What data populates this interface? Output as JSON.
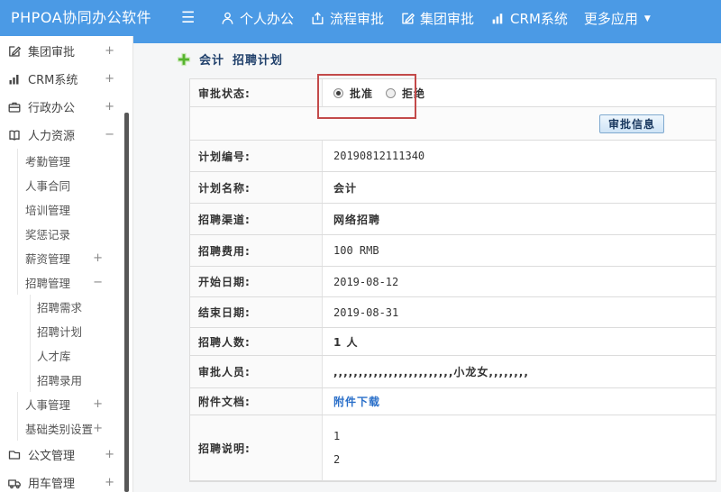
{
  "header": {
    "logo": "PHPOA协同办公软件",
    "menu_icon": "hamburger-menu-icon",
    "nav": [
      {
        "id": "personal-office",
        "label": "个人办公",
        "icon": "person-icon"
      },
      {
        "id": "process-approval",
        "label": "流程审批",
        "icon": "flow-icon"
      },
      {
        "id": "group-approval",
        "label": "集团审批",
        "icon": "edit-icon"
      },
      {
        "id": "crm-system",
        "label": "CRM系统",
        "icon": "chart-icon"
      },
      {
        "id": "more-apps",
        "label": "更多应用",
        "icon": "",
        "caret": "caret-down-icon"
      }
    ],
    "bar_color": "#4b9ae5"
  },
  "sidebar": {
    "items": [
      {
        "id": "group-approval",
        "label": "集团审批",
        "level": 1,
        "icon": "edit-icon",
        "exp": "+"
      },
      {
        "id": "crm-system",
        "label": "CRM系统",
        "level": 1,
        "icon": "chart-icon",
        "exp": "+"
      },
      {
        "id": "admin-office",
        "label": "行政办公",
        "level": 1,
        "icon": "briefcase-icon",
        "exp": "+"
      },
      {
        "id": "human-resources",
        "label": "人力资源",
        "level": 1,
        "icon": "book-icon",
        "exp": "−"
      },
      {
        "id": "attendance-mgmt",
        "label": "考勤管理",
        "level": 2,
        "exp": ""
      },
      {
        "id": "hr-contract",
        "label": "人事合同",
        "level": 2,
        "exp": ""
      },
      {
        "id": "training-mgmt",
        "label": "培训管理",
        "level": 2,
        "exp": ""
      },
      {
        "id": "reward-punish",
        "label": "奖惩记录",
        "level": 2,
        "exp": ""
      },
      {
        "id": "salary-mgmt",
        "label": "薪资管理",
        "level": 2,
        "exp": "+"
      },
      {
        "id": "recruit-mgmt",
        "label": "招聘管理",
        "level": 2,
        "exp": "−"
      },
      {
        "id": "recruit-demand",
        "label": "招聘需求",
        "level": 3,
        "exp": ""
      },
      {
        "id": "recruit-plan",
        "label": "招聘计划",
        "level": 3,
        "exp": ""
      },
      {
        "id": "talent-pool",
        "label": "人才库",
        "level": 3,
        "exp": ""
      },
      {
        "id": "recruit-hire",
        "label": "招聘录用",
        "level": 3,
        "exp": ""
      },
      {
        "id": "personnel-mgmt",
        "label": "人事管理",
        "level": 2,
        "exp": "+"
      },
      {
        "id": "base-category",
        "label": "基础类别设置",
        "level": 2,
        "exp": "+"
      },
      {
        "id": "document-mgmt",
        "label": "公文管理",
        "level": 1,
        "icon": "doc-icon",
        "exp": "+"
      },
      {
        "id": "vehicle-mgmt",
        "label": "用车管理",
        "level": 1,
        "icon": "truck-icon",
        "exp": "+"
      }
    ]
  },
  "main": {
    "page_title": {
      "doc": "会计",
      "module": "招聘计划",
      "icon": "plus-icon"
    },
    "annotation_color": "#c34a4a",
    "form": {
      "rows": [
        {
          "id": "approval-status",
          "label": "审批状态:",
          "type": "radios",
          "options": [
            {
              "label": "批准",
              "checked": true
            },
            {
              "label": "拒绝",
              "checked": false
            }
          ]
        },
        {
          "id": "approval-info",
          "label": "",
          "type": "button",
          "button_label": "审批信息"
        },
        {
          "id": "plan-number",
          "label": "计划编号:",
          "value": "20190812111340",
          "latin": true
        },
        {
          "id": "plan-name",
          "label": "计划名称:",
          "value": "会计"
        },
        {
          "id": "recruit-channel",
          "label": "招聘渠道:",
          "value": "网络招聘"
        },
        {
          "id": "recruit-cost",
          "label": "招聘费用:",
          "value": "100 RMB",
          "latin": true
        },
        {
          "id": "start-date",
          "label": "开始日期:",
          "value": "2019-08-12",
          "latin": true
        },
        {
          "id": "end-date",
          "label": "结束日期:",
          "value": "2019-08-31",
          "latin": true
        },
        {
          "id": "recruit-count",
          "label": "招聘人数:",
          "value": "1 人"
        },
        {
          "id": "approvers",
          "label": "审批人员:",
          "value": ",,,,,,,,,,,,,,,,,,,,,,,,小龙女,,,,,,,,",
          "commas": true
        },
        {
          "id": "attachment",
          "label": "附件文档:",
          "type": "link",
          "value": "附件下载",
          "link_color": "#2a6fc9"
        },
        {
          "id": "recruit-description",
          "label": "招聘说明:",
          "type": "multiline",
          "lines": [
            "1",
            "2"
          ]
        }
      ]
    }
  }
}
